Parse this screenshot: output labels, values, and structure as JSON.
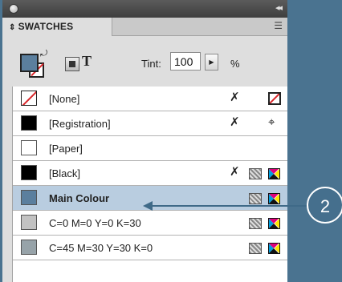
{
  "panel": {
    "tab_label": "SWATCHES",
    "tab_arrows": "⇕",
    "menu_icon": "☰",
    "collapse_icon": "◂◂"
  },
  "toolbar": {
    "tint_label": "Tint:",
    "tint_value": "100",
    "tint_arrow": "▶",
    "percent": "%",
    "text_button": "T",
    "fill_color": "#5b7f9e"
  },
  "swatches": [
    {
      "name": "[None]",
      "color": "none",
      "locked": true,
      "type": "none"
    },
    {
      "name": "[Registration]",
      "color": "#000000",
      "locked": true,
      "type": "registration"
    },
    {
      "name": "[Paper]",
      "color": "#ffffff"
    },
    {
      "name": "[Black]",
      "color": "#000000",
      "locked": true,
      "type": "process-cmyk"
    },
    {
      "name": "Main Colour",
      "color": "#5b7f9e",
      "type": "process-cmyk",
      "selected": true
    },
    {
      "name": "C=0 M=0 Y=0 K=30",
      "color": "#c2c2c2",
      "type": "process-cmyk"
    },
    {
      "name": "C=45 M=30 Y=30 K=0",
      "color": "#97a3a9",
      "type": "process-cmyk"
    }
  ],
  "callout": {
    "number": "2"
  },
  "colors": {
    "background": "#4a7390",
    "selected_row": "#b9cde0",
    "accent": "#456f8d"
  }
}
